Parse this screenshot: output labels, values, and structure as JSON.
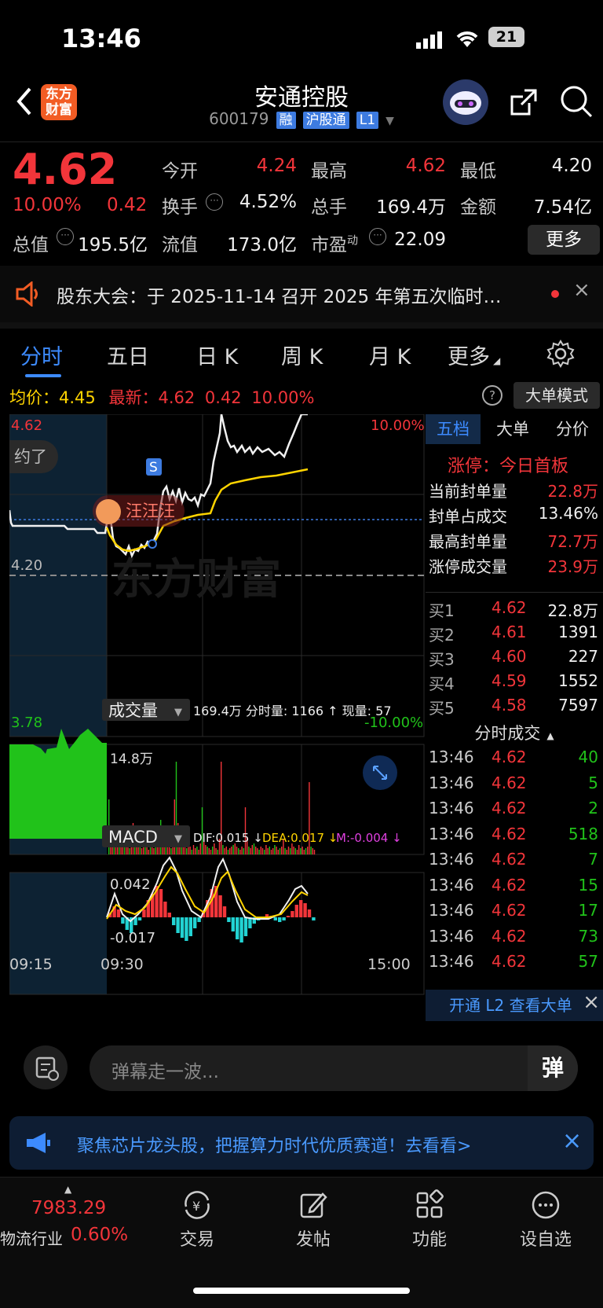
{
  "status_bar": {
    "time": "13:46",
    "battery": "21"
  },
  "header": {
    "title": "安通控股",
    "code": "600179",
    "tags": [
      "融",
      "沪股通",
      "L1"
    ],
    "logo_line1": "东方",
    "logo_line2": "财富"
  },
  "quote": {
    "price": "4.62",
    "change_pct": "10.00%",
    "change_amt": "0.42",
    "open_label": "今开",
    "open_value": "4.24",
    "high_label": "最高",
    "high_value": "4.62",
    "low_label": "最低",
    "low_value": "4.20",
    "turnover_label": "换手",
    "turnover_value": "4.52%",
    "volume_label": "总手",
    "volume_value": "169.4万",
    "amount_label": "金额",
    "amount_value": "7.54亿",
    "mktcap_label": "总值",
    "mktcap_value": "195.5亿",
    "float_label": "流值",
    "float_value": "173.0亿",
    "pe_label": "市盈",
    "pe_sup": "动",
    "pe_value": "22.09",
    "more_button": "更多"
  },
  "notice": {
    "text": "股东大会：于 2025-11-14 召开 2025 年第五次临时…"
  },
  "tabs": [
    "分时",
    "五日",
    "日 K",
    "周 K",
    "月 K",
    "更多"
  ],
  "chart_header": {
    "avg_label": "均价：",
    "avg_value": "4.45",
    "latest_label": "最新：",
    "latest_value": "4.62",
    "latest_change": "0.42",
    "latest_pct": "10.00%",
    "big_order_button": "大单模式"
  },
  "chart": {
    "price_high": "4.62",
    "price_base": "4.20",
    "price_low": "3.78",
    "pct_high": "10.00%",
    "pct_low": "-10.00%",
    "watermark": "东方财富",
    "danmaku_user": "汪汪汪",
    "danmaku_bubble": "约了",
    "marker": "S",
    "volume_label": "成交量",
    "volume_stats": "169.4万  分时量: 1166 ↑  现量: 57",
    "volume_max": "14.8万",
    "macd_label": "MACD",
    "dif": "DIF:0.015 ↓",
    "dea": "DEA:0.017 ↓",
    "m": "M:-0.004 ↓",
    "macd_max": "0.042",
    "macd_min": "-0.017",
    "time_start": "09:15",
    "time_open": "09:30",
    "time_end": "15:00"
  },
  "right_panel": {
    "tabs": [
      "五档",
      "大单",
      "分价"
    ],
    "limit_up_title": "涨停：今日首板",
    "seal_rows": [
      {
        "label": "当前封单量",
        "value": "22.8万"
      },
      {
        "label": "封单占成交",
        "value": "13.46%"
      },
      {
        "label": "最高封单量",
        "value": "72.7万"
      },
      {
        "label": "涨停成交量",
        "value": "23.9万"
      }
    ],
    "bids": [
      {
        "label": "买1",
        "price": "4.62",
        "vol": "22.8万"
      },
      {
        "label": "买2",
        "price": "4.61",
        "vol": "1391"
      },
      {
        "label": "买3",
        "price": "4.60",
        "vol": "227"
      },
      {
        "label": "买4",
        "price": "4.59",
        "vol": "1552"
      },
      {
        "label": "买5",
        "price": "4.58",
        "vol": "7597"
      }
    ],
    "ticks_title": "分时成交",
    "ticks": [
      {
        "time": "13:46",
        "price": "4.62",
        "vol": "40"
      },
      {
        "time": "13:46",
        "price": "4.62",
        "vol": "5"
      },
      {
        "time": "13:46",
        "price": "4.62",
        "vol": "2"
      },
      {
        "time": "13:46",
        "price": "4.62",
        "vol": "518"
      },
      {
        "time": "13:46",
        "price": "4.62",
        "vol": "7"
      },
      {
        "time": "13:46",
        "price": "4.62",
        "vol": "15"
      },
      {
        "time": "13:46",
        "price": "4.62",
        "vol": "17"
      },
      {
        "time": "13:46",
        "price": "4.62",
        "vol": "73"
      },
      {
        "time": "13:46",
        "price": "4.62",
        "vol": "57"
      }
    ],
    "l2_banner": "开通 L2 查看大单"
  },
  "comment": {
    "placeholder": "弹幕走一波...",
    "send_glyph": "弹"
  },
  "promo": {
    "text": "聚焦芯片龙头股，把握算力时代优质赛道！去看看>"
  },
  "bottom_nav": {
    "index_value": "7983.29",
    "index_name": "物流行业",
    "index_pct": "0.60%",
    "items": [
      "交易",
      "发帖",
      "功能",
      "设自选"
    ]
  },
  "colors": {
    "up": "#f2353a",
    "down": "#21c21a",
    "avg": "#ffd400",
    "accent": "#3d7be0"
  }
}
